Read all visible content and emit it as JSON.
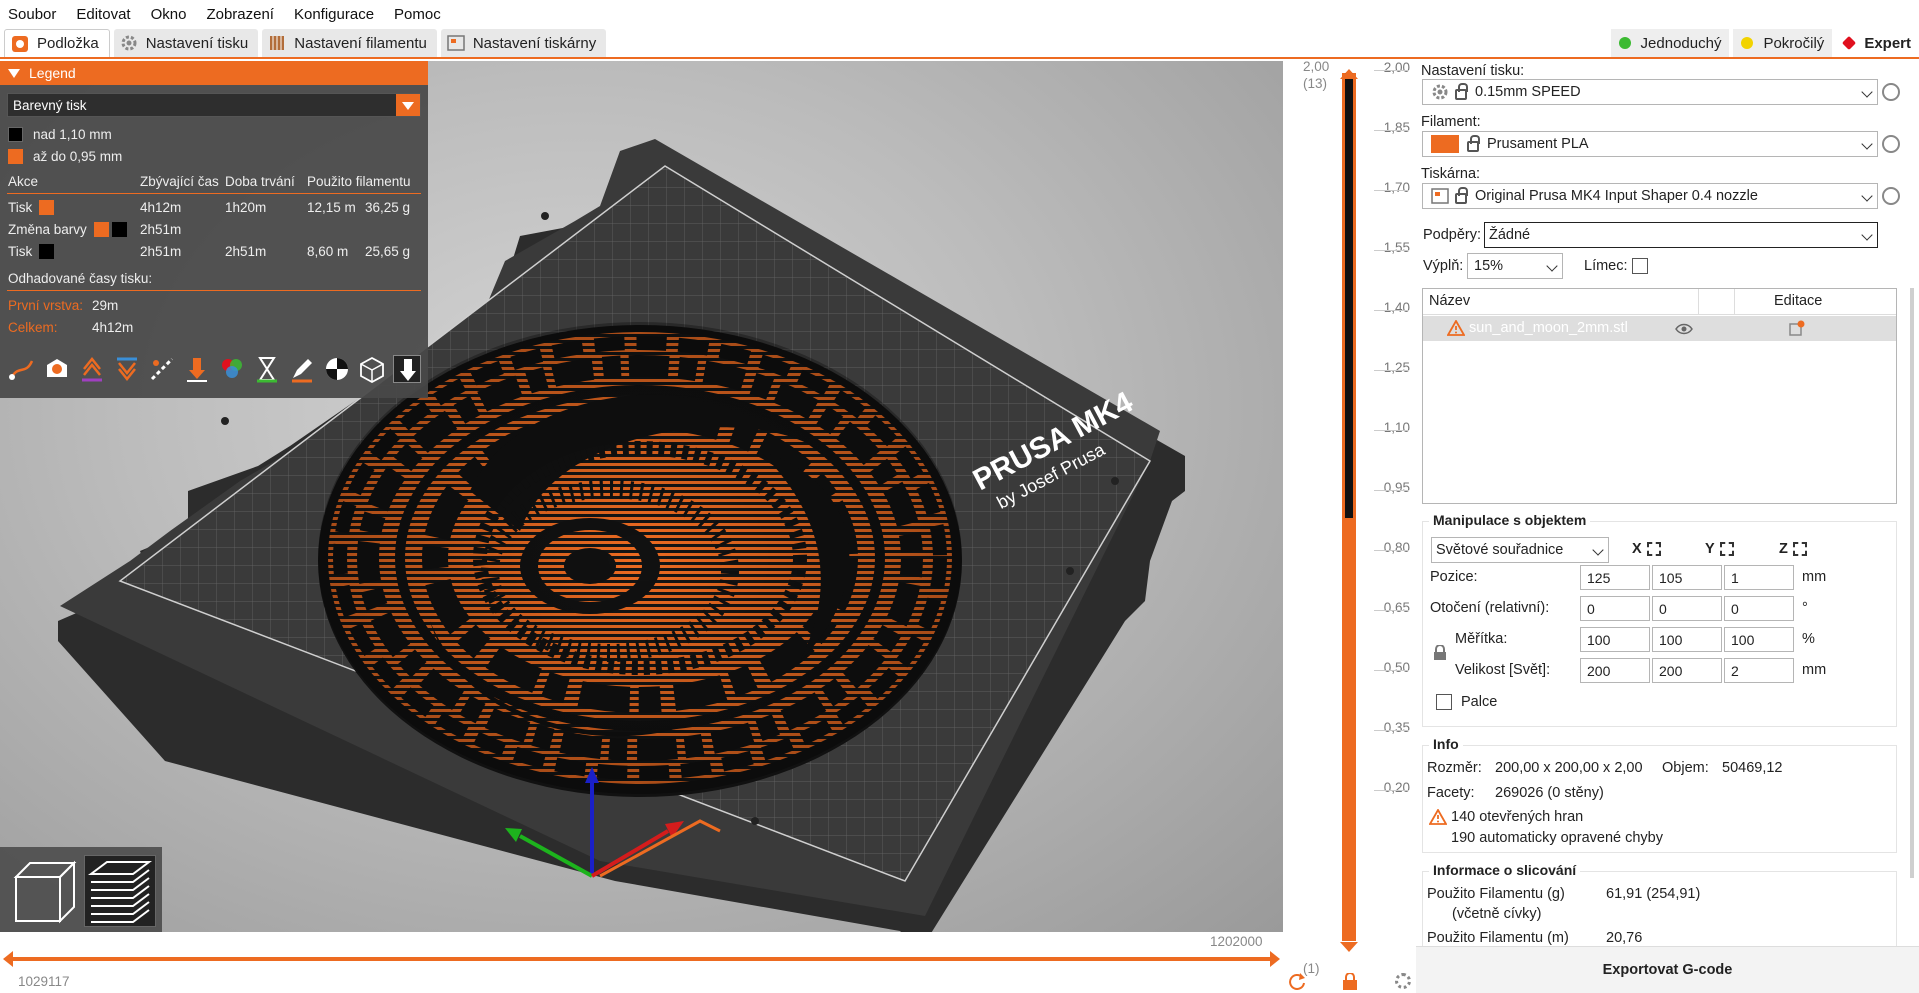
{
  "menu": [
    "Soubor",
    "Editovat",
    "Okno",
    "Zobrazení",
    "Konfigurace",
    "Pomoc"
  ],
  "tabs": [
    {
      "label": "Podložka",
      "icon": "plater-icon",
      "active": true
    },
    {
      "label": "Nastavení tisku",
      "icon": "print-settings-gear-icon",
      "active": false
    },
    {
      "label": "Nastavení filamentu",
      "icon": "filament-spool-icon",
      "active": false
    },
    {
      "label": "Nastavení tiskárny",
      "icon": "printer-icon",
      "active": false
    }
  ],
  "modes": [
    {
      "label": "Jednoduchý",
      "color": "#3cba32"
    },
    {
      "label": "Pokročilý",
      "color": "#f2d300"
    },
    {
      "label": "Expert",
      "color": "#e0101e"
    }
  ],
  "legend": {
    "title": "Legend",
    "view_type": "Barevný tisk",
    "ranges": [
      {
        "label": "nad 1,10 mm",
        "color": "#000000"
      },
      {
        "label": "až do 0,95 mm",
        "color": "#ed6b21"
      }
    ],
    "headers": [
      "Akce",
      "Zbývající čas",
      "Doba trvání",
      "Použito filamentu"
    ],
    "rows": [
      {
        "action": "Tisk",
        "remaining": "4h12m",
        "duration": "1h20m",
        "length": "12,15 m",
        "weight": "36,25 g"
      },
      {
        "action": "Změna barvy",
        "remaining": "2h51m",
        "duration": "",
        "length": "",
        "weight": ""
      },
      {
        "action": "Tisk",
        "remaining": "2h51m",
        "duration": "2h51m",
        "length": "8,60 m",
        "weight": "25,65 g"
      }
    ],
    "estimated_title": "Odhadované časy tisku:",
    "first_layer_label": "První vrstva:",
    "first_layer_value": "29m",
    "total_label": "Celkem:",
    "total_value": "4h12m"
  },
  "bed": {
    "brand_text": "PRUSA MK4",
    "brand_sub": "by Josef Prusa"
  },
  "vertical_slider": {
    "top_value": "2,00",
    "top_layer": "(13)",
    "bottom_value": "0,20",
    "bottom_layer": "(1)",
    "ticks": [
      "2,00",
      "1,85",
      "1,70",
      "1,55",
      "1,40",
      "1,25",
      "1,10",
      "0,95",
      "0,80",
      "0,65",
      "0,50",
      "0,35",
      "0,20"
    ],
    "color_change_at": 1.1
  },
  "horizontal_slider": {
    "left_value": "1029117",
    "right_value": "1202000"
  },
  "sidebar": {
    "print_settings_label": "Nastavení tisku:",
    "print_profile": "0.15mm SPEED",
    "filament_label": "Filament:",
    "filament_profile": "Prusament PLA",
    "filament_color": "#ed6b21",
    "printer_label": "Tiskárna:",
    "printer_profile": "Original Prusa MK4 Input Shaper 0.4 nozzle",
    "supports_label": "Podpěry:",
    "supports_value": "Žádné",
    "infill_label": "Výplň:",
    "infill_value": "15%",
    "brim_label": "Límec:",
    "list_header_name": "Název",
    "list_header_edit": "Editace",
    "object_name": "sun_and_moon_2mm.stl",
    "manip_title": "Manipulace s objektem",
    "coord_system": "Světové souřadnice",
    "axes": [
      "X",
      "Y",
      "Z"
    ],
    "position_label": "Pozice:",
    "position": [
      "125",
      "105",
      "1"
    ],
    "position_unit": "mm",
    "rotation_label": "Otočení (relativní):",
    "rotation": [
      "0",
      "0",
      "0"
    ],
    "rotation_unit": "°",
    "scale_label": "Měřítka:",
    "scale": [
      "100",
      "100",
      "100"
    ],
    "scale_unit": "%",
    "size_label": "Velikost [Svět]:",
    "size": [
      "200",
      "200",
      "2"
    ],
    "size_unit": "mm",
    "inches_label": "Palce",
    "info_title": "Info",
    "size_info_label": "Rozměr:",
    "size_info_value": "200,00 x 200,00 x 2,00",
    "volume_label": "Objem:",
    "volume_value": "50469,12",
    "facets_label": "Facety:",
    "facets_value": "269026 (0 stěny)",
    "open_edges": "140 otevřených hran",
    "auto_fixed": "190 automaticky opravené chyby",
    "slice_title": "Informace o slicování",
    "filament_used_g_label": "Použito Filamentu (g)",
    "filament_used_g_sub": "(včetně cívky)",
    "filament_used_g_value": "61,91 (254,91)",
    "filament_used_m_label": "Použito Filamentu (m)",
    "filament_used_m_value": "20,76",
    "export_label": "Exportovat G-code"
  }
}
